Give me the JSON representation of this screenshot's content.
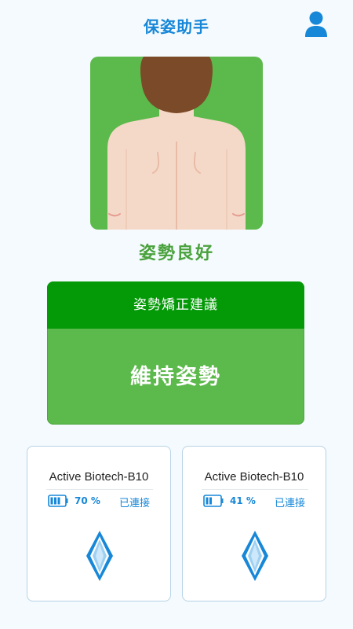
{
  "header": {
    "title": "保姿助手",
    "user_icon": "user-profile-icon"
  },
  "posture": {
    "image_icon": "back-posture-illustration",
    "status": "姿勢良好"
  },
  "advice": {
    "header": "姿勢矯正建議",
    "suggestion": "維持姿勢"
  },
  "devices": [
    {
      "name": "Active Biotech-B10",
      "battery": "70 %",
      "battery_level": 0.7,
      "status": "已連接",
      "icon": "diamond-sensor-icon"
    },
    {
      "name": "Active Biotech-B10",
      "battery": "41 %",
      "battery_level": 0.41,
      "status": "已連接",
      "icon": "diamond-sensor-icon"
    }
  ],
  "colors": {
    "primary_blue": "#1787d8",
    "good_green": "#5cb94b",
    "dark_green": "#049a07",
    "status_green": "#4aa23d",
    "background": "#f4fafd"
  }
}
